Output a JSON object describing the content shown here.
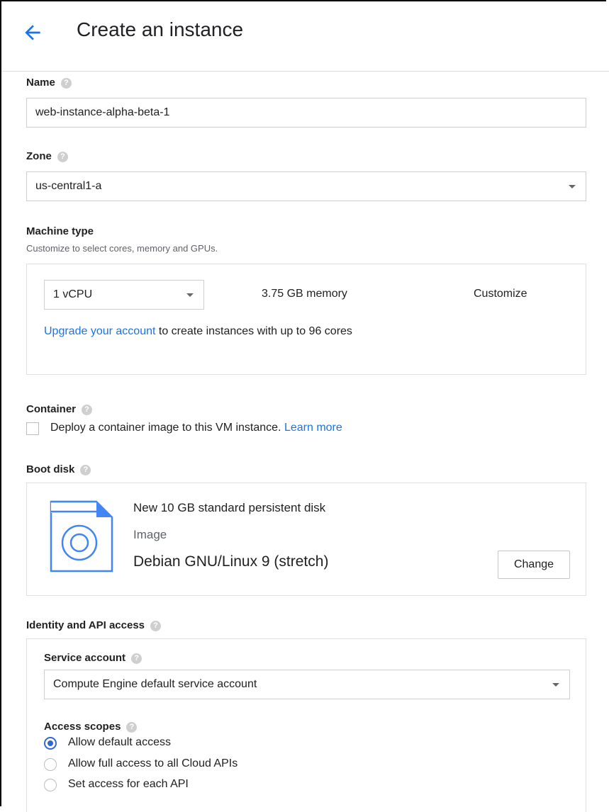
{
  "header": {
    "title": "Create an instance"
  },
  "name": {
    "label": "Name",
    "value": "web-instance-alpha-beta-1"
  },
  "zone": {
    "label": "Zone",
    "value": "us-central1-a"
  },
  "machine_type": {
    "label": "Machine type",
    "subtitle": "Customize to select cores, memory and GPUs.",
    "cpu": "1 vCPU",
    "memory": "3.75 GB memory",
    "customize_label": "Customize",
    "upgrade_link": "Upgrade your account",
    "upgrade_text": " to create instances with up to 96 cores"
  },
  "container": {
    "label": "Container",
    "checkbox_text": "Deploy a container image to this VM instance.",
    "learn_more": "Learn more",
    "checked": false
  },
  "boot_disk": {
    "label": "Boot disk",
    "disk_title": "New 10 GB standard persistent disk",
    "image_label": "Image",
    "image_name": "Debian GNU/Linux 9 (stretch)",
    "change_label": "Change",
    "icon": "disk-image-icon"
  },
  "identity": {
    "label": "Identity and API access",
    "service_account_label": "Service account",
    "service_account_value": "Compute Engine default service account",
    "access_scopes_label": "Access scopes",
    "scopes": [
      {
        "label": "Allow default access",
        "checked": true
      },
      {
        "label": "Allow full access to all Cloud APIs",
        "checked": false
      },
      {
        "label": "Set access for each API",
        "checked": false
      }
    ]
  },
  "colors": {
    "link": "#1a73e8",
    "radio_accent": "#3367d6",
    "disk_icon": "#4285f4"
  },
  "icons": {
    "help": "?"
  }
}
